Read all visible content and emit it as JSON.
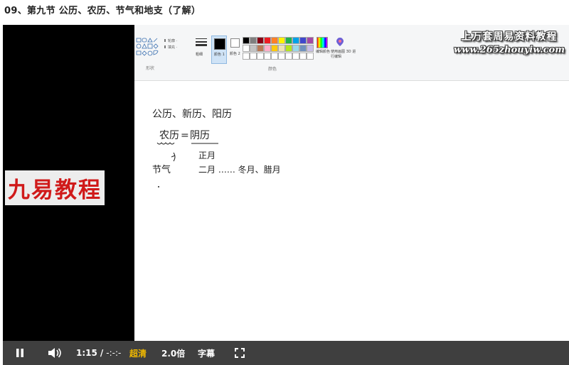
{
  "page_title": "09、第九节 公历、农历、节气和地支（了解）",
  "watermarks": {
    "left": "九易教程",
    "top_line1": "上万套周易资料教程",
    "top_line2": "www.265zhouyiw.com"
  },
  "ribbon": {
    "shapes_group_label": "形状",
    "colors_group_label": "颜色",
    "outline_label": "轮廓",
    "fill_label": "填充",
    "stroke_label": "粗细",
    "color1_label": "颜色 1",
    "color2_label": "颜色 2",
    "edit_colors_label": "编辑颜色",
    "paint3d_label": "使用画图 3D 进行编辑",
    "palette": [
      "#000000",
      "#7f7f7f",
      "#880015",
      "#ed1c24",
      "#ff7f27",
      "#fff200",
      "#22b14c",
      "#00a2e8",
      "#3f48cc",
      "#a349a4",
      "#ffffff",
      "#c3c3c3",
      "#b97a57",
      "#ffaec9",
      "#ffc90e",
      "#efe4b0",
      "#b5e61d",
      "#99d9ea",
      "#7092be",
      "#c8bfe7",
      "#ffffff",
      "#ffffff",
      "#ffffff",
      "#ffffff",
      "#ffffff",
      "#ffffff",
      "#ffffff",
      "#ffffff",
      "#ffffff",
      "#ffffff"
    ]
  },
  "handwriting": {
    "line1": "公历、新历、阳历",
    "line2_left": "农历",
    "line2_right": "阴历",
    "line3": "正月",
    "line4_left": "节气",
    "line4_right": "二月 …… 冬月、腊月"
  },
  "controls": {
    "play_state": "pause-icon",
    "volume_icon": "speaker-icon",
    "time_current": "1:15",
    "time_separator": "/",
    "time_total": "-:-:-",
    "quality": "超清",
    "speed": "2.0倍",
    "subtitles": "字幕",
    "fullscreen_icon": "fullscreen-icon",
    "accent_color": "#f0b800"
  }
}
